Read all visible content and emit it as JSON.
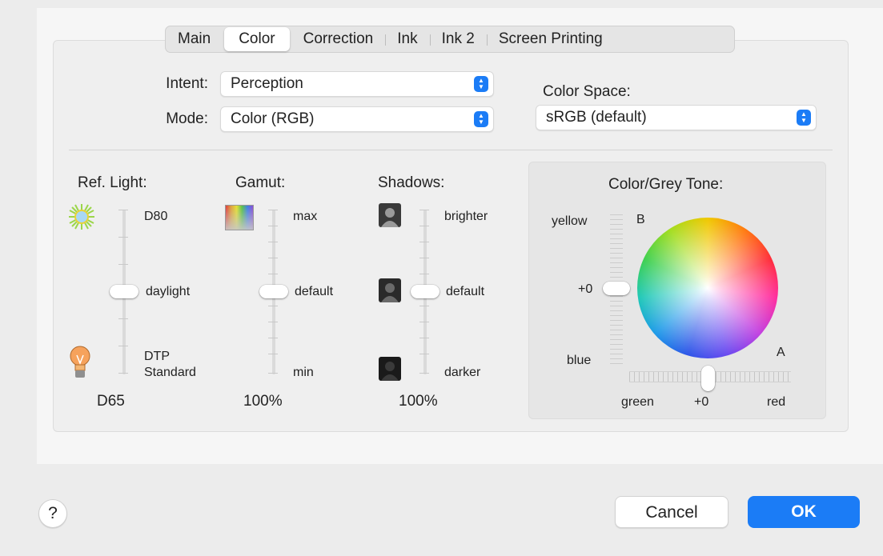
{
  "tabs": [
    "Main",
    "Color",
    "Correction",
    "Ink",
    "Ink 2",
    "Screen Printing"
  ],
  "active_tab": "Color",
  "intent": {
    "label": "Intent:",
    "value": "Perception"
  },
  "mode": {
    "label": "Mode:",
    "value": "Color (RGB)"
  },
  "color_space": {
    "label": "Color Space:",
    "value": "sRGB (default)"
  },
  "ref_light": {
    "heading": "Ref. Light:",
    "top": "D80",
    "mid": "daylight",
    "bottom_1": "DTP",
    "bottom_2": "Standard",
    "value": "D65",
    "slider_level": 0.5
  },
  "gamut": {
    "heading": "Gamut:",
    "top": "max",
    "mid": "default",
    "bottom": "min",
    "value": "100%",
    "slider_level": 0.5
  },
  "shadows": {
    "heading": "Shadows:",
    "top": "brighter",
    "mid": "default",
    "bottom": "darker",
    "value": "100%",
    "slider_level": 0.5
  },
  "tone": {
    "heading": "Color/Grey Tone:",
    "yellow": "yellow",
    "zero": "+0",
    "blue": "blue",
    "b_label": "B",
    "a_label": "A",
    "green": "green",
    "h_zero": "+0",
    "red": "red"
  },
  "buttons": {
    "help": "?",
    "cancel": "Cancel",
    "ok": "OK"
  },
  "colors": {
    "accent": "#1b7cf6"
  },
  "icons": [
    "sun-icon",
    "bulb-icon",
    "gamut-icon",
    "silhouette-icon"
  ]
}
